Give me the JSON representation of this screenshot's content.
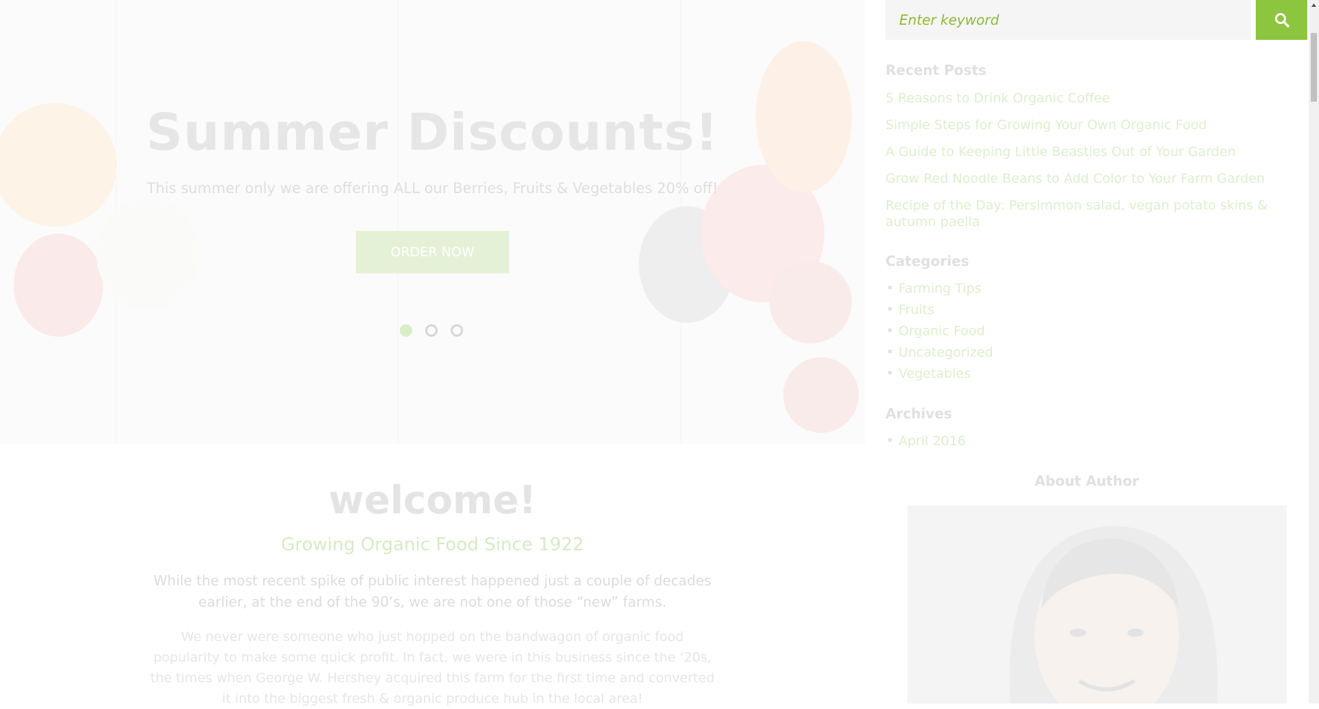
{
  "hero": {
    "title": "Summer Discounts!",
    "subtitle": "This summer only we are offering ALL our Berries, Fruits & Vegetables 20% off!",
    "button_label": "ORDER NOW",
    "slides_count": 3,
    "active_slide": 1
  },
  "welcome": {
    "title": "welcome!",
    "subtitle": "Growing Organic Food Since 1922",
    "lead": "While the most recent spike of public interest happened just a couple of decades earlier, at the end of the 90’s, we are not one of those “new” farms.",
    "body": "We never were someone who just hopped on the bandwagon of organic food popularity to make some quick profit. In fact, we were in this business since the ‘20s, the times when George W. Hershey acquired this farm for the first time and converted it into the biggest fresh & organic produce hub in the local area!"
  },
  "sidebar": {
    "search": {
      "placeholder": "Enter keyword",
      "icon": "search-icon"
    },
    "recent_posts": {
      "title": "Recent Posts",
      "items": [
        "5 Reasons to Drink Organic Coffee",
        "Simple Steps for Growing Your Own Organic Food",
        "A Guide to Keeping Little Beasties Out of Your Garden",
        "Grow Red Noodle Beans to Add Color to Your Farm Garden",
        "Recipe of the Day: Persimmon salad, vegan potato skins & autumn paella"
      ]
    },
    "categories": {
      "title": "Categories",
      "items": [
        "Farming Tips",
        "Fruits",
        "Organic Food",
        "Uncategorized",
        "Vegetables"
      ]
    },
    "archives": {
      "title": "Archives",
      "items": [
        "April 2016"
      ]
    },
    "about": {
      "title": "About Author"
    }
  },
  "colors": {
    "accent": "#8cc63f",
    "accent_text": "#8cba37",
    "search_bg": "#f5f5f5"
  }
}
